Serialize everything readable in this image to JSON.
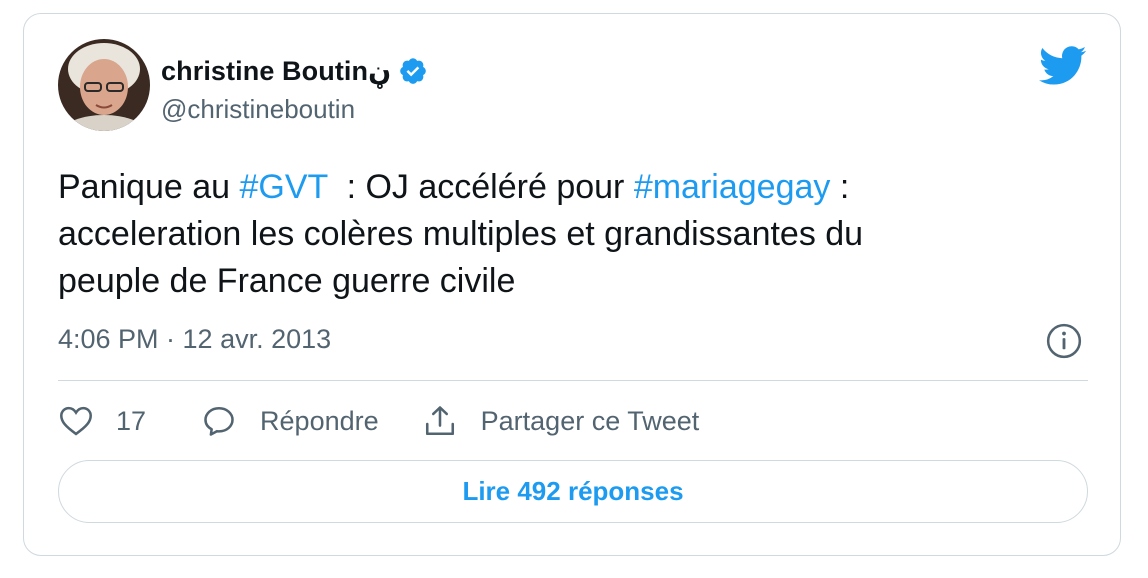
{
  "author": {
    "display_name": "christine Boutinڼ",
    "handle": "@christineboutin",
    "verified": true
  },
  "tweet": {
    "text_parts": [
      {
        "text": "Panique au ",
        "hashtag": false
      },
      {
        "text": "#GVT",
        "hashtag": true
      },
      {
        "text": "  : OJ accéléré pour ",
        "hashtag": false
      },
      {
        "text": "#mariagegay",
        "hashtag": true
      },
      {
        "text": " :\nacceleration les colères multiples et grandissantes du\npeuple de France guerre civile",
        "hashtag": false
      }
    ],
    "timestamp": "4:06 PM · 12 avr. 2013"
  },
  "actions": {
    "like_count": "17",
    "reply_label": "Répondre",
    "share_label": "Partager ce Tweet"
  },
  "replies_button": {
    "label": "Lire 492 réponses"
  },
  "icons": {
    "brand": "twitter-bird-icon",
    "verified": "verified-badge-icon",
    "info": "info-icon",
    "like": "heart-icon",
    "reply": "speech-bubble-icon",
    "share": "share-upload-icon"
  },
  "colors": {
    "accent": "#1d9bf0",
    "text": "#0f1419",
    "secondary_text": "#536471",
    "border": "#cfd9de"
  }
}
